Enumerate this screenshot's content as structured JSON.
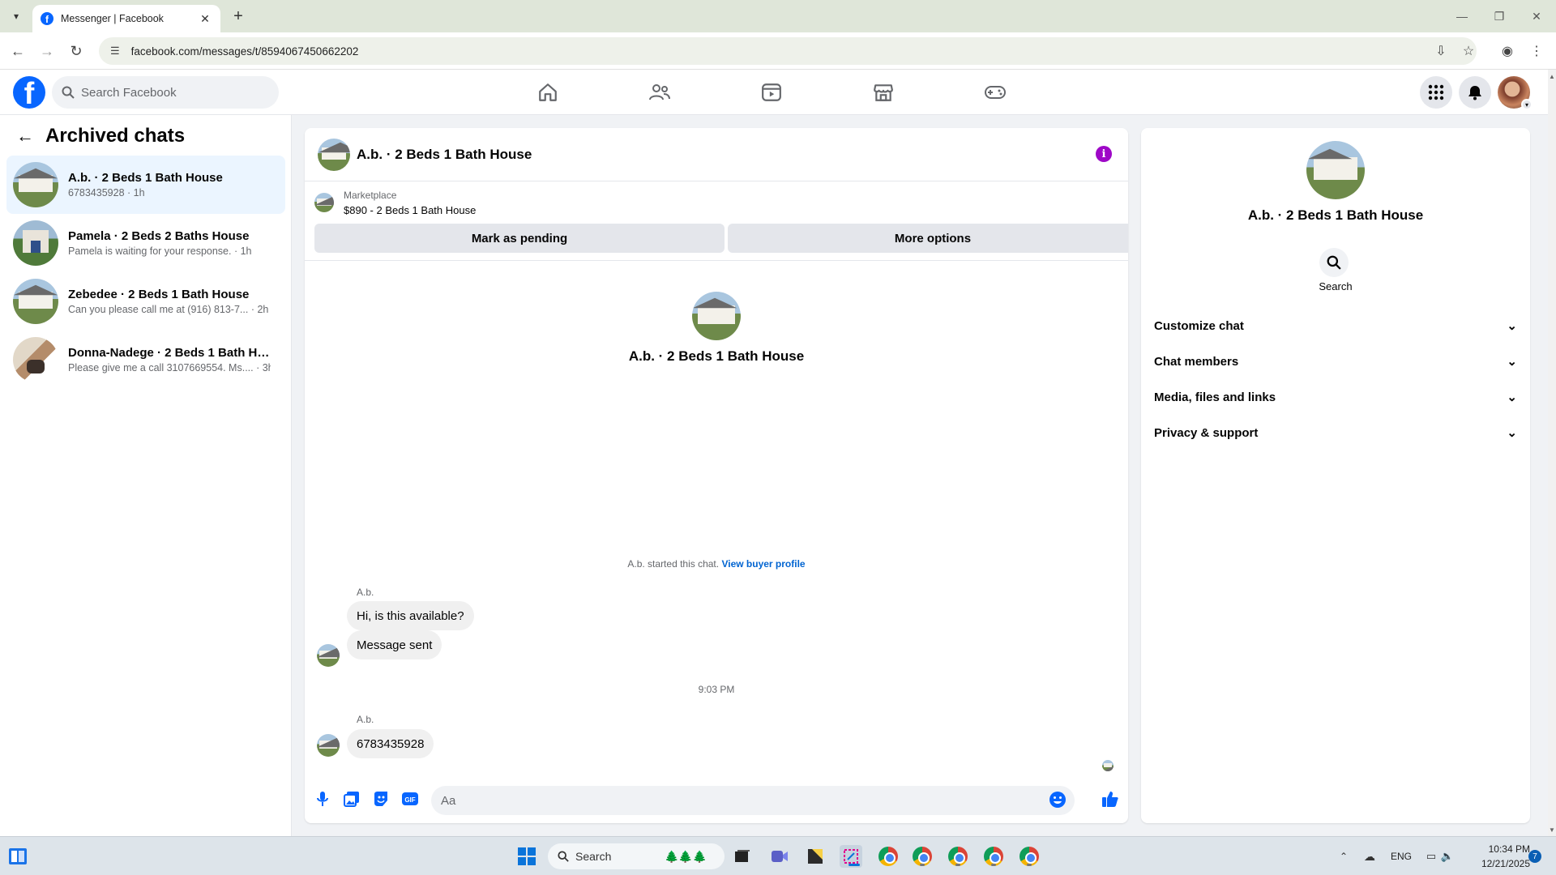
{
  "browser": {
    "tab_title": "Messenger | Facebook",
    "url": "facebook.com/messages/t/8594067450662202"
  },
  "fb_header": {
    "search_placeholder": "Search Facebook"
  },
  "sidebar": {
    "title": "Archived chats",
    "chats": [
      {
        "name": "A.b. · 2 Beds 1 Bath House",
        "preview": "6783435928 · 1h",
        "active": true
      },
      {
        "name": "Pamela · 2 Beds 2 Baths House",
        "preview": "Pamela is waiting for your response. · 1h",
        "active": false
      },
      {
        "name": "Zebedee · 2 Beds 1 Bath House",
        "preview": "Can you please call me at (916) 813-7... · 2h",
        "active": false
      },
      {
        "name": "Donna-Nadege · 2 Beds 1 Bath Ho...",
        "preview": "Please give me a call 3107669554. Ms.... · 3h",
        "active": false
      }
    ]
  },
  "chat": {
    "header_name": "A.b. · 2 Beds 1 Bath House",
    "marketplace_label": "Marketplace",
    "listing": "$890 - 2 Beds 1 Bath House",
    "mark_pending": "Mark as pending",
    "more_options": "More options",
    "intro_name": "A.b. · 2 Beds 1 Bath House",
    "started_text": "A.b. started this chat.",
    "view_buyer": "View buyer profile",
    "messages": [
      {
        "sender": "A.b.",
        "text": "Hi, is this available?"
      },
      {
        "text": "Message sent"
      },
      {
        "sender": "A.b.",
        "text": "6783435928"
      }
    ],
    "timestamp": "9:03 PM",
    "composer_placeholder": "Aa"
  },
  "info_panel": {
    "name": "A.b. · 2 Beds 1 Bath House",
    "search_label": "Search",
    "sections": [
      "Customize chat",
      "Chat members",
      "Media, files and links",
      "Privacy & support"
    ]
  },
  "taskbar": {
    "search_placeholder": "Search",
    "language": "ENG",
    "time": "10:34 PM",
    "date": "12/21/2025",
    "notification_count": "7"
  },
  "colors": {
    "facebook_blue": "#0866ff",
    "info_purple": "#9e08c7",
    "active_chat_bg": "#ebf5ff",
    "link_blue": "#0064d1"
  }
}
